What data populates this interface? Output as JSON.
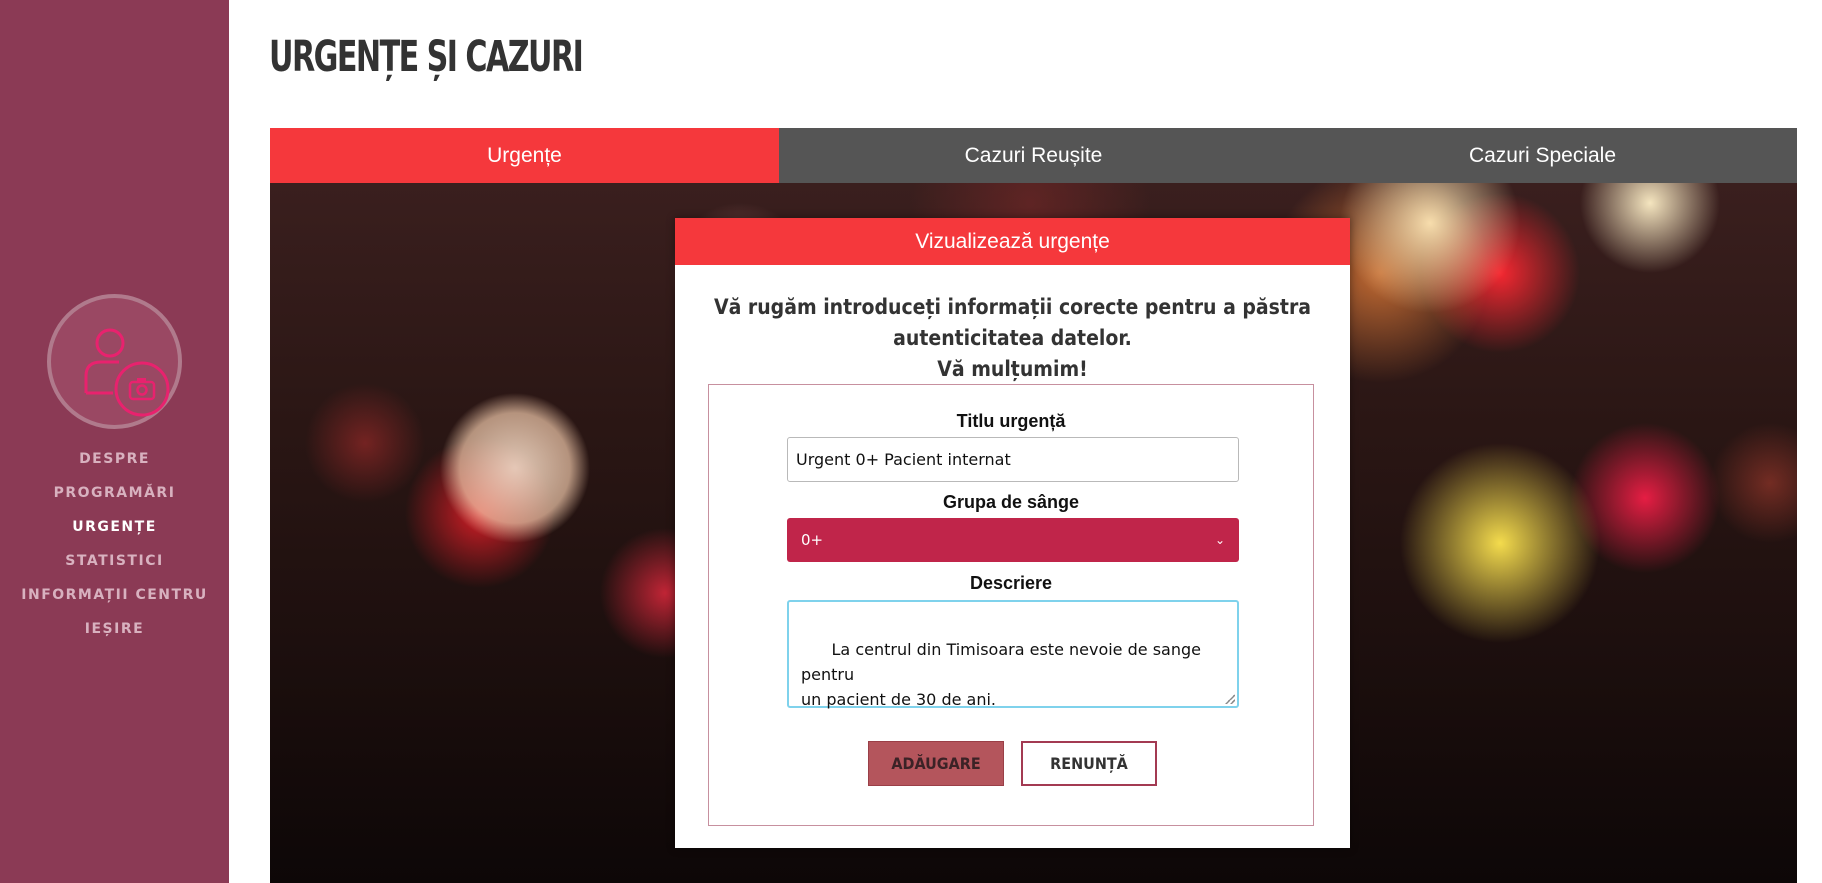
{
  "page": {
    "title": "URGENȚE ȘI CAZURI"
  },
  "sidebar": {
    "avatar_icon": "user-camera-icon",
    "items": [
      {
        "label": "DESPRE"
      },
      {
        "label": "PROGRAMĂRI"
      },
      {
        "label": "URGENȚE",
        "active": true
      },
      {
        "label": "STATISTICI"
      },
      {
        "label": "INFORMAȚII CENTRU"
      },
      {
        "label": "IEȘIRE"
      }
    ]
  },
  "tabs": [
    {
      "label": "Urgențe",
      "active": true
    },
    {
      "label": "Cazuri Reușite"
    },
    {
      "label": "Cazuri Speciale"
    }
  ],
  "card": {
    "header": "Vizualizează urgențe",
    "notice_line1": "Vă rugăm introduceți informații corecte pentru a păstra autenticitatea datelor.",
    "notice_line2": "Vă mulțumim!",
    "form": {
      "title_label": "Titlu urgență",
      "title_value": "Urgent 0+ Pacient internat",
      "blood_label": "Grupa de sânge",
      "blood_value": "0+",
      "description_label": "Descriere",
      "description_value": "La centrul din Timisoara este nevoie de sange pentru\nun pacient de 30 de ani.",
      "add_button": "ADĂUGARE",
      "cancel_button": "RENUNȚĂ"
    }
  },
  "colors": {
    "sidebar_bg": "#8b3a55",
    "accent_red": "#f5383c",
    "tab_inactive": "#555555",
    "select_bg": "#c0254a",
    "add_button_bg": "#b4555c"
  }
}
